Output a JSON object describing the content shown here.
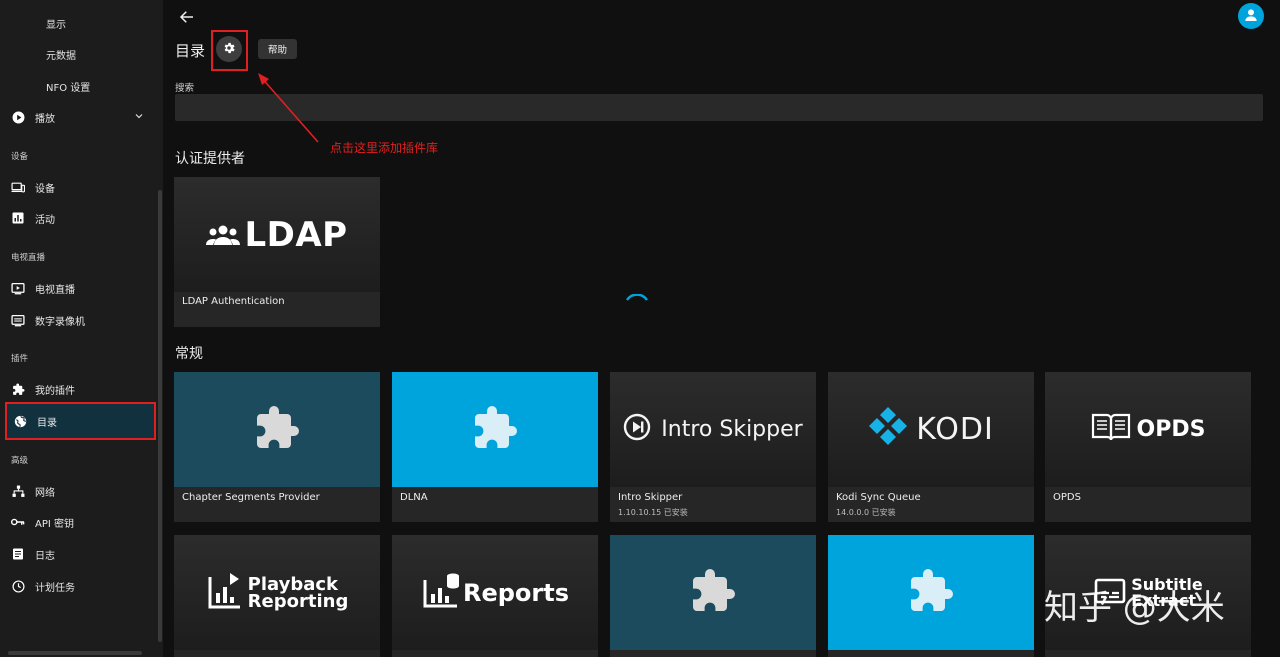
{
  "sidebar": {
    "display_sub": "显示",
    "metadata_sub": "元数据",
    "nfo_sub": "NFO 设置",
    "playback": "播放",
    "devices_header": "设备",
    "devices": "设备",
    "activity": "活动",
    "livetv_header": "电视直播",
    "livetv": "电视直播",
    "dvr": "数字录像机",
    "plugins_header": "插件",
    "my_plugins": "我的插件",
    "catalog": "目录",
    "advanced_header": "高级",
    "network": "网络",
    "api_keys": "API 密钥",
    "logs": "日志",
    "scheduled_tasks": "计划任务"
  },
  "header": {
    "title": "目录",
    "help_label": "帮助"
  },
  "search": {
    "label": "搜索",
    "value": "",
    "placeholder": ""
  },
  "annotation": "点击这里添加插件库",
  "sections": {
    "auth_title": "认证提供者",
    "general_title": "常规"
  },
  "auth_cards": [
    {
      "name": "LDAP Authentication",
      "logo_text": "LDAP"
    }
  ],
  "general_cards": [
    {
      "name": "Chapter Segments Provider",
      "version": ""
    },
    {
      "name": "DLNA",
      "version": ""
    },
    {
      "name": "Intro Skipper",
      "version": "1.10.10.15 已安装",
      "logo_text": "Intro Skipper"
    },
    {
      "name": "Kodi Sync Queue",
      "version": "14.0.0.0 已安装",
      "logo_text": "KODI"
    },
    {
      "name": "OPDS",
      "version": "",
      "logo_text": "OPDS"
    }
  ],
  "row3_cards": [
    {
      "logo_line1": "Playback",
      "logo_line2": "Reporting"
    },
    {
      "logo_text": "Reports"
    },
    {},
    {},
    {
      "logo_line1": "Subtitle",
      "logo_line2": "Extract"
    }
  ],
  "watermark": "知乎 @大米",
  "colors": {
    "accent": "#00a4dc",
    "teal_tile": "#1c4b5d",
    "annotation_red": "#e02020",
    "background": "#101010",
    "sidebar_bg": "#1c1c1c"
  },
  "icons": {
    "back": "arrow-left-icon",
    "settings": "gear-icon",
    "user": "user-icon",
    "plugin": "puzzle-icon"
  }
}
